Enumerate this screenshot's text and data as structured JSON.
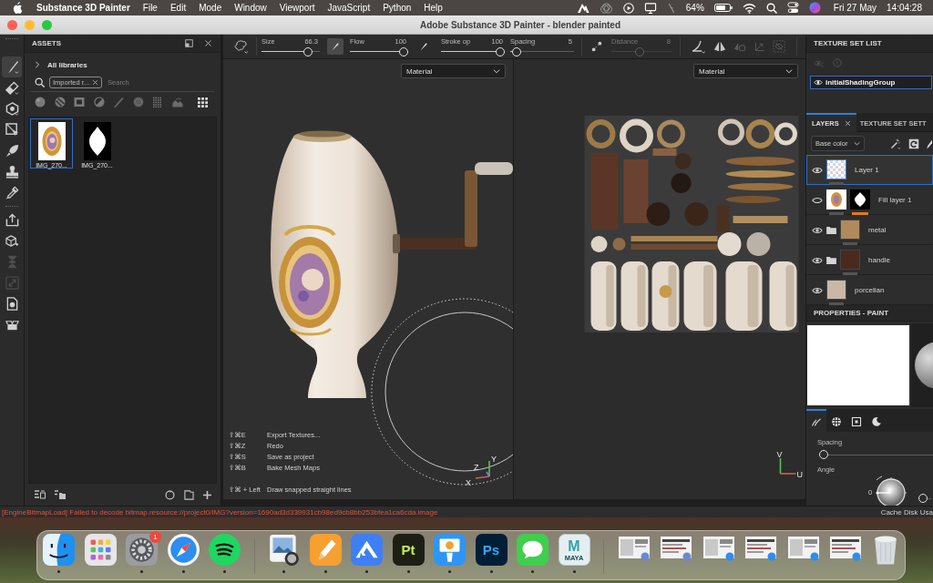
{
  "menu_bar": {
    "app_name": "Substance 3D Painter",
    "menus": [
      "File",
      "Edit",
      "Mode",
      "Window",
      "Viewport",
      "JavaScript",
      "Python",
      "Help"
    ],
    "battery": "64%",
    "date": "Fri 27 May",
    "time": "14:04:28"
  },
  "window": {
    "title": "Adobe Substance 3D Painter - blender painted"
  },
  "tool_strip": {
    "tools": [
      {
        "selected": true,
        "disabled": false
      },
      {
        "selected": false,
        "disabled": false
      },
      {
        "selected": false,
        "disabled": false
      },
      {
        "selected": false,
        "disabled": false
      },
      {
        "selected": false,
        "disabled": false
      },
      {
        "selected": false,
        "disabled": false
      },
      {
        "selected": false,
        "disabled": false
      },
      {
        "selected": false,
        "disabled": false
      },
      {
        "selected": false,
        "disabled": false
      },
      {
        "selected": false,
        "disabled": true
      },
      {
        "selected": false,
        "disabled": true
      },
      {
        "selected": false,
        "disabled": false
      },
      {
        "selected": false,
        "disabled": false
      }
    ]
  },
  "assets": {
    "title": "ASSETS",
    "breadcrumb": "All libraries",
    "filter_tag": "Imported r...",
    "search": {
      "placeholder": "Search"
    },
    "items": [
      {
        "name": "IMG_270...",
        "kind": "image",
        "selected": true
      },
      {
        "name": "IMG_270...",
        "kind": "mask",
        "selected": false
      }
    ]
  },
  "toolbar": {
    "sliders": [
      {
        "label": "Size",
        "reading": "66.3",
        "level": 0.85,
        "disabled": false,
        "toggle_on": true
      },
      {
        "label": "Flow",
        "reading": "100",
        "level": 1,
        "disabled": false,
        "toggle_on": false
      },
      {
        "label": "Stroke op",
        "reading": "100",
        "level": 1,
        "disabled": false
      },
      {
        "label": "Spacing",
        "reading": "5",
        "level": 0.03,
        "disabled": false
      },
      {
        "label": "Distance",
        "reading": "8",
        "level": 0.45,
        "disabled": true
      }
    ]
  },
  "viewports": [
    {
      "kind": "scene",
      "dropdown": "Material",
      "axes": [
        "X",
        "Y",
        "Z"
      ]
    },
    {
      "kind": "texture",
      "dropdown": "Material",
      "axes": [
        "V",
        "U"
      ]
    }
  ],
  "shortcuts": [
    {
      "keys": "⇧⌘E",
      "action": "Export Textures..."
    },
    {
      "keys": "⇧⌘Z",
      "action": "Redo"
    },
    {
      "keys": "⇧⌘S",
      "action": "Save as project"
    },
    {
      "keys": "⇧⌘B",
      "action": "Bake Mesh Maps"
    },
    {
      "keys": "⇧⌘ + Left",
      "action": "Draw snapped straight lines"
    }
  ],
  "texture_set_list": {
    "title": "TEXTURE SET LIST",
    "items": [
      {
        "name": "initialShadingGroup",
        "selected": true
      }
    ]
  },
  "layers": {
    "tabs": [
      {
        "label": "LAYERS",
        "selected": true
      },
      {
        "label": "TEXTURE SET SETT",
        "selected": false
      }
    ],
    "channel": "Base color",
    "items": [
      {
        "name": "Layer 1",
        "kind": "paint",
        "visible": true,
        "selected": true
      },
      {
        "name": "Fill layer 1",
        "kind": "masked",
        "visible": false,
        "selected": false
      },
      {
        "name": "metal",
        "kind": "folder",
        "color": "#b08a5a",
        "visible": true,
        "selected": false
      },
      {
        "name": "handle",
        "kind": "folder",
        "color": "#4a2a1c",
        "visible": true,
        "selected": false
      },
      {
        "name": "porcelian",
        "kind": "fill",
        "color": "#c9b8a8",
        "visible": true,
        "selected": false
      }
    ]
  },
  "properties": {
    "title": "PROPERTIES - PAINT",
    "tabs": [
      {
        "selected": true
      },
      {
        "selected": false
      },
      {
        "selected": false
      },
      {
        "selected": false
      }
    ],
    "spacing": {
      "label": "Spacing",
      "level": 0
    },
    "angle": {
      "label": "Angle",
      "reading": "0",
      "level": 0
    }
  },
  "status_bar": {
    "message": "[EngineBitmapLoad] Failed to decode bitmap.resource://project0/IMG?version=1690ad3d339931cb98ed9cb8bb253bfea1ca6cda.image",
    "cache": "Cache Disk Usa"
  },
  "dock": {
    "apps": [
      {
        "running": true
      },
      {
        "running": false
      },
      {
        "running": true,
        "badge": "1"
      },
      {
        "running": true
      },
      {
        "running": true
      },
      {
        "running": true
      },
      {
        "running": true
      },
      {
        "running": true
      },
      {
        "running": true,
        "label": "Pt"
      },
      {
        "running": true
      },
      {
        "running": true,
        "label": "Ps"
      },
      {
        "running": true
      },
      {
        "running": true,
        "logo": "M",
        "label": "MAYA"
      }
    ]
  }
}
